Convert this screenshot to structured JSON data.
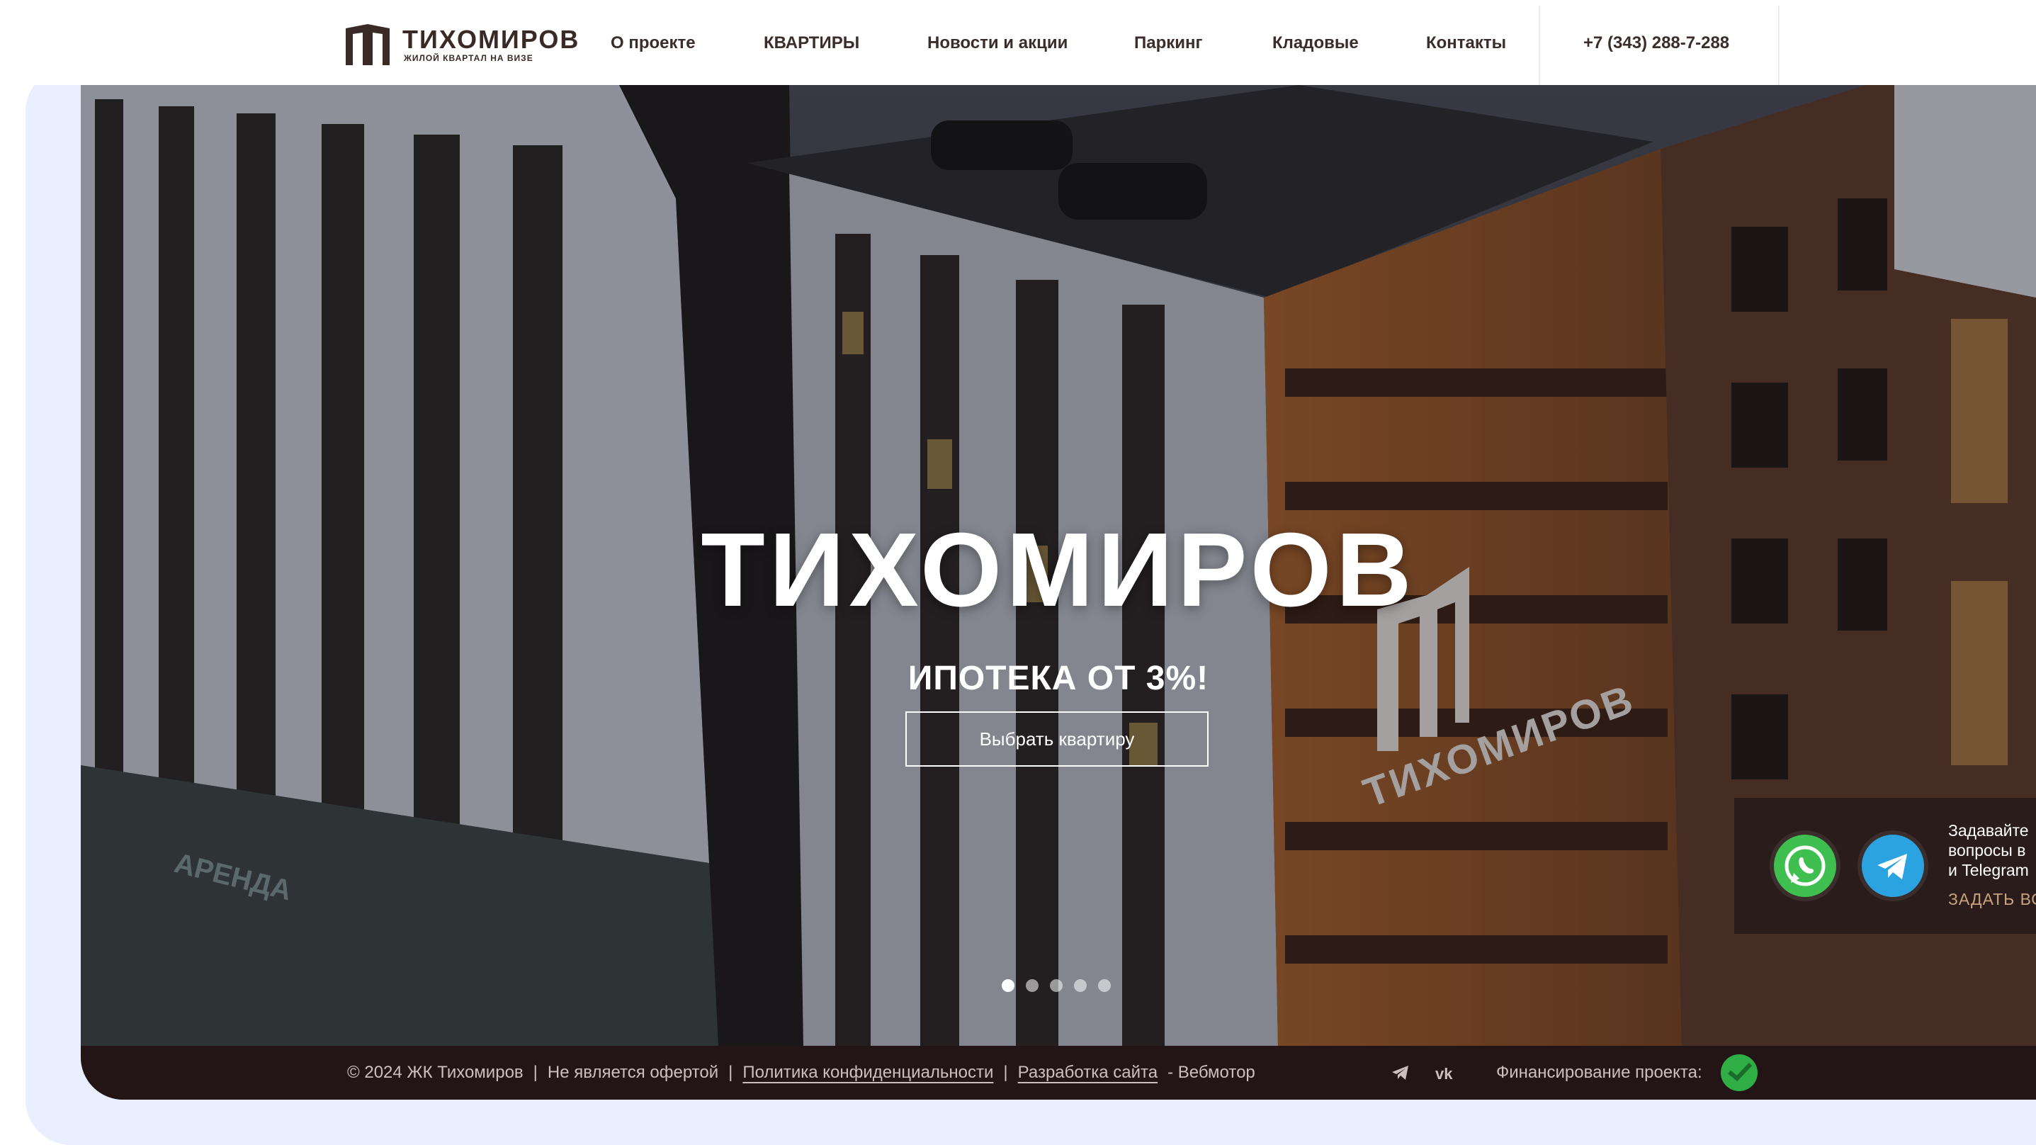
{
  "brand": {
    "name": "ТИХОМИРОВ",
    "tagline": "ЖИЛОЙ КВАРТАЛ НА ВИЗЕ"
  },
  "nav": {
    "items": [
      "О проекте",
      "КВАРТИРЫ",
      "Новости и акции",
      "Паркинг",
      "Кладовые",
      "Контакты"
    ],
    "phone": "+7 (343) 288-7-288"
  },
  "hero": {
    "title": "ТИХОМИРОВ",
    "subtitle": "ИПОТЕКА ОТ 3%!",
    "cta_label": "Выбрать квартиру",
    "slides_total": 5,
    "active_slide": 1,
    "building_sign": "ТИХОМИРОВ",
    "storefront_sign": "АРЕНДА"
  },
  "messenger": {
    "text": "Задавайте\nвопросы в\nи Telegram",
    "link_label": "ЗАДАТЬ ВО",
    "icons": [
      "whatsapp-icon",
      "telegram-icon"
    ]
  },
  "footer": {
    "copyright": "© 2024 ЖК Тихомиров",
    "not_offer": "Не является офертой",
    "privacy": "Политика конфиденциальности",
    "dev_link": "Разработка сайта",
    "dev_name": "- Вебмотор",
    "financing": "Финансирование проекта:",
    "social_icons": [
      "telegram-icon",
      "vk-icon"
    ]
  },
  "colors": {
    "brand_dark": "#3a2a26",
    "backdrop": "#e9efff",
    "footer_bg": "#231515",
    "accent_orange": "#b8692f"
  }
}
